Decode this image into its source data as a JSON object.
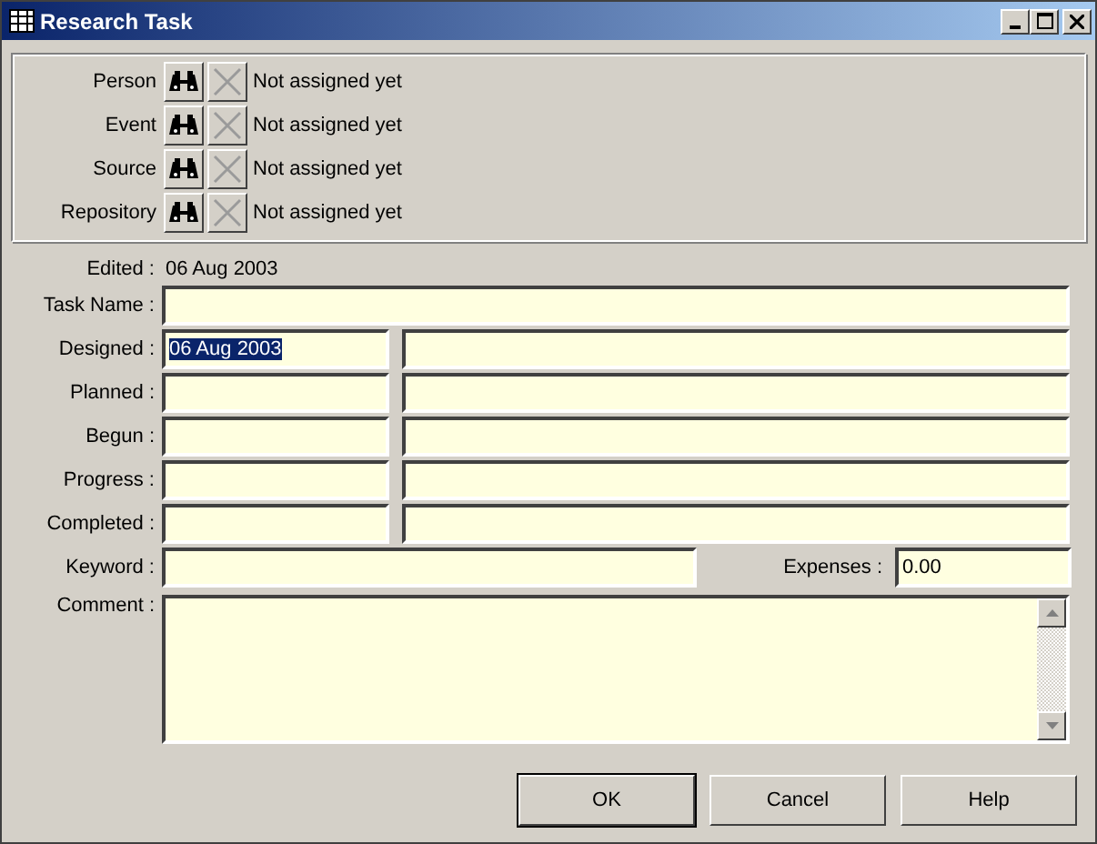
{
  "window": {
    "title": "Research Task"
  },
  "links": [
    {
      "label": "Person",
      "value": "Not assigned yet",
      "clear_disabled": true
    },
    {
      "label": "Event",
      "value": "Not assigned yet",
      "clear_disabled": true
    },
    {
      "label": "Source",
      "value": "Not assigned yet",
      "clear_disabled": true
    },
    {
      "label": "Repository",
      "value": "Not assigned yet",
      "clear_disabled": true
    }
  ],
  "edited": {
    "label": "Edited :",
    "value": "06 Aug 2003"
  },
  "task_name": {
    "label": "Task Name :"
  },
  "dates": [
    {
      "label": "Designed :",
      "date": "06 Aug 2003",
      "date_selected": true
    },
    {
      "label": "Planned :"
    },
    {
      "label": "Begun :"
    },
    {
      "label": "Progress :"
    },
    {
      "label": "Completed :"
    }
  ],
  "keyword": {
    "label": "Keyword :"
  },
  "expenses": {
    "label": "Expenses :",
    "value": "0.00"
  },
  "comment": {
    "label": "Comment :"
  },
  "buttons": [
    "OK",
    "Cancel",
    "Help"
  ]
}
